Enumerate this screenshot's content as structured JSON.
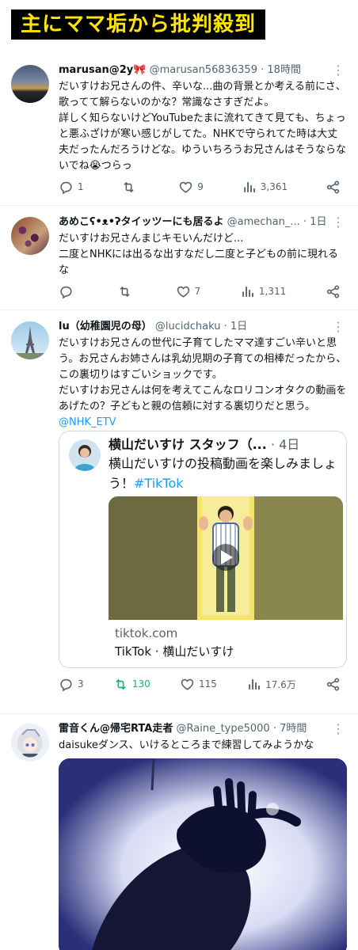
{
  "banner": {
    "text": "主にママ垢から批判殺到"
  },
  "tweets": [
    {
      "name": "marusan@2y🎀",
      "handle": "@marusan56836359",
      "time": "18時間",
      "text": "だいすけお兄さんの件、辛いな...曲の背景とか考える前にさ、歌ってて解らないのかな？常識なさすぎだよ。\n詳しく知らないけどYouTubeたまに流れてきて見ても、ちょっと悪ふざけが寒い感じがしてた。NHKで守られてた時は大丈夫だったんだろうけどな。ゆういちろうお兄さんはそうならないでね😭つらっ",
      "replies": "1",
      "retweets": "",
      "likes": "9",
      "views": "3,361"
    },
    {
      "name": "あめこʕ•ᴥ•ʔタイッツーにも居るよ",
      "handle": "@amechan_...",
      "time": "1日",
      "text": "だいすけお兄さんまじキモいんだけど...\n二度とNHKには出るな出すなだし二度と子どもの前に現れるな",
      "replies": "",
      "retweets": "",
      "likes": "7",
      "views": "1,311"
    },
    {
      "name": "lu（幼稚園児の母）",
      "handle": "@lucidchaku",
      "time": "1日",
      "text": "だいすけお兄さんの世代に子育てしたママ達すごい辛いと思う。お兄さんお姉さんは乳幼児期の子育ての相棒だったから、この裏切りはすごいショックです。\nだいすけお兄さんは何を考えてこんなロリコンオタクの動画をあげたの？子どもと親の信頼に対する裏切りだと思う。",
      "mention": "@NHK_ETV",
      "replies": "3",
      "retweets": "130",
      "likes": "115",
      "views": "17.6万",
      "quote": {
        "name": "横山だいすけ スタッフ（...",
        "time": "4日",
        "text": "横山だいすけの投稿動画を楽しみましょう！",
        "hashtag": "#TikTok",
        "domain": "tiktok.com",
        "title": "TikTok · 横山だいすけ"
      }
    },
    {
      "name": "雷音くん@帰宅RTA走者",
      "handle": "@Raine_type5000",
      "time": "7時間",
      "text": "daisukeダンス、いけるところまで練習してみようかな"
    }
  ],
  "icons": {
    "reply": "reply-icon",
    "retweet": "retweet-icon",
    "like": "heart-icon",
    "views": "views-icon",
    "share": "share-icon",
    "more": "more-icon",
    "play": "play-icon"
  },
  "colors": {
    "banner_bg": "#000000",
    "banner_text": "#ffe600",
    "link": "#1d9bf0",
    "retweet_active": "#00ba7c",
    "muted": "#536471"
  }
}
